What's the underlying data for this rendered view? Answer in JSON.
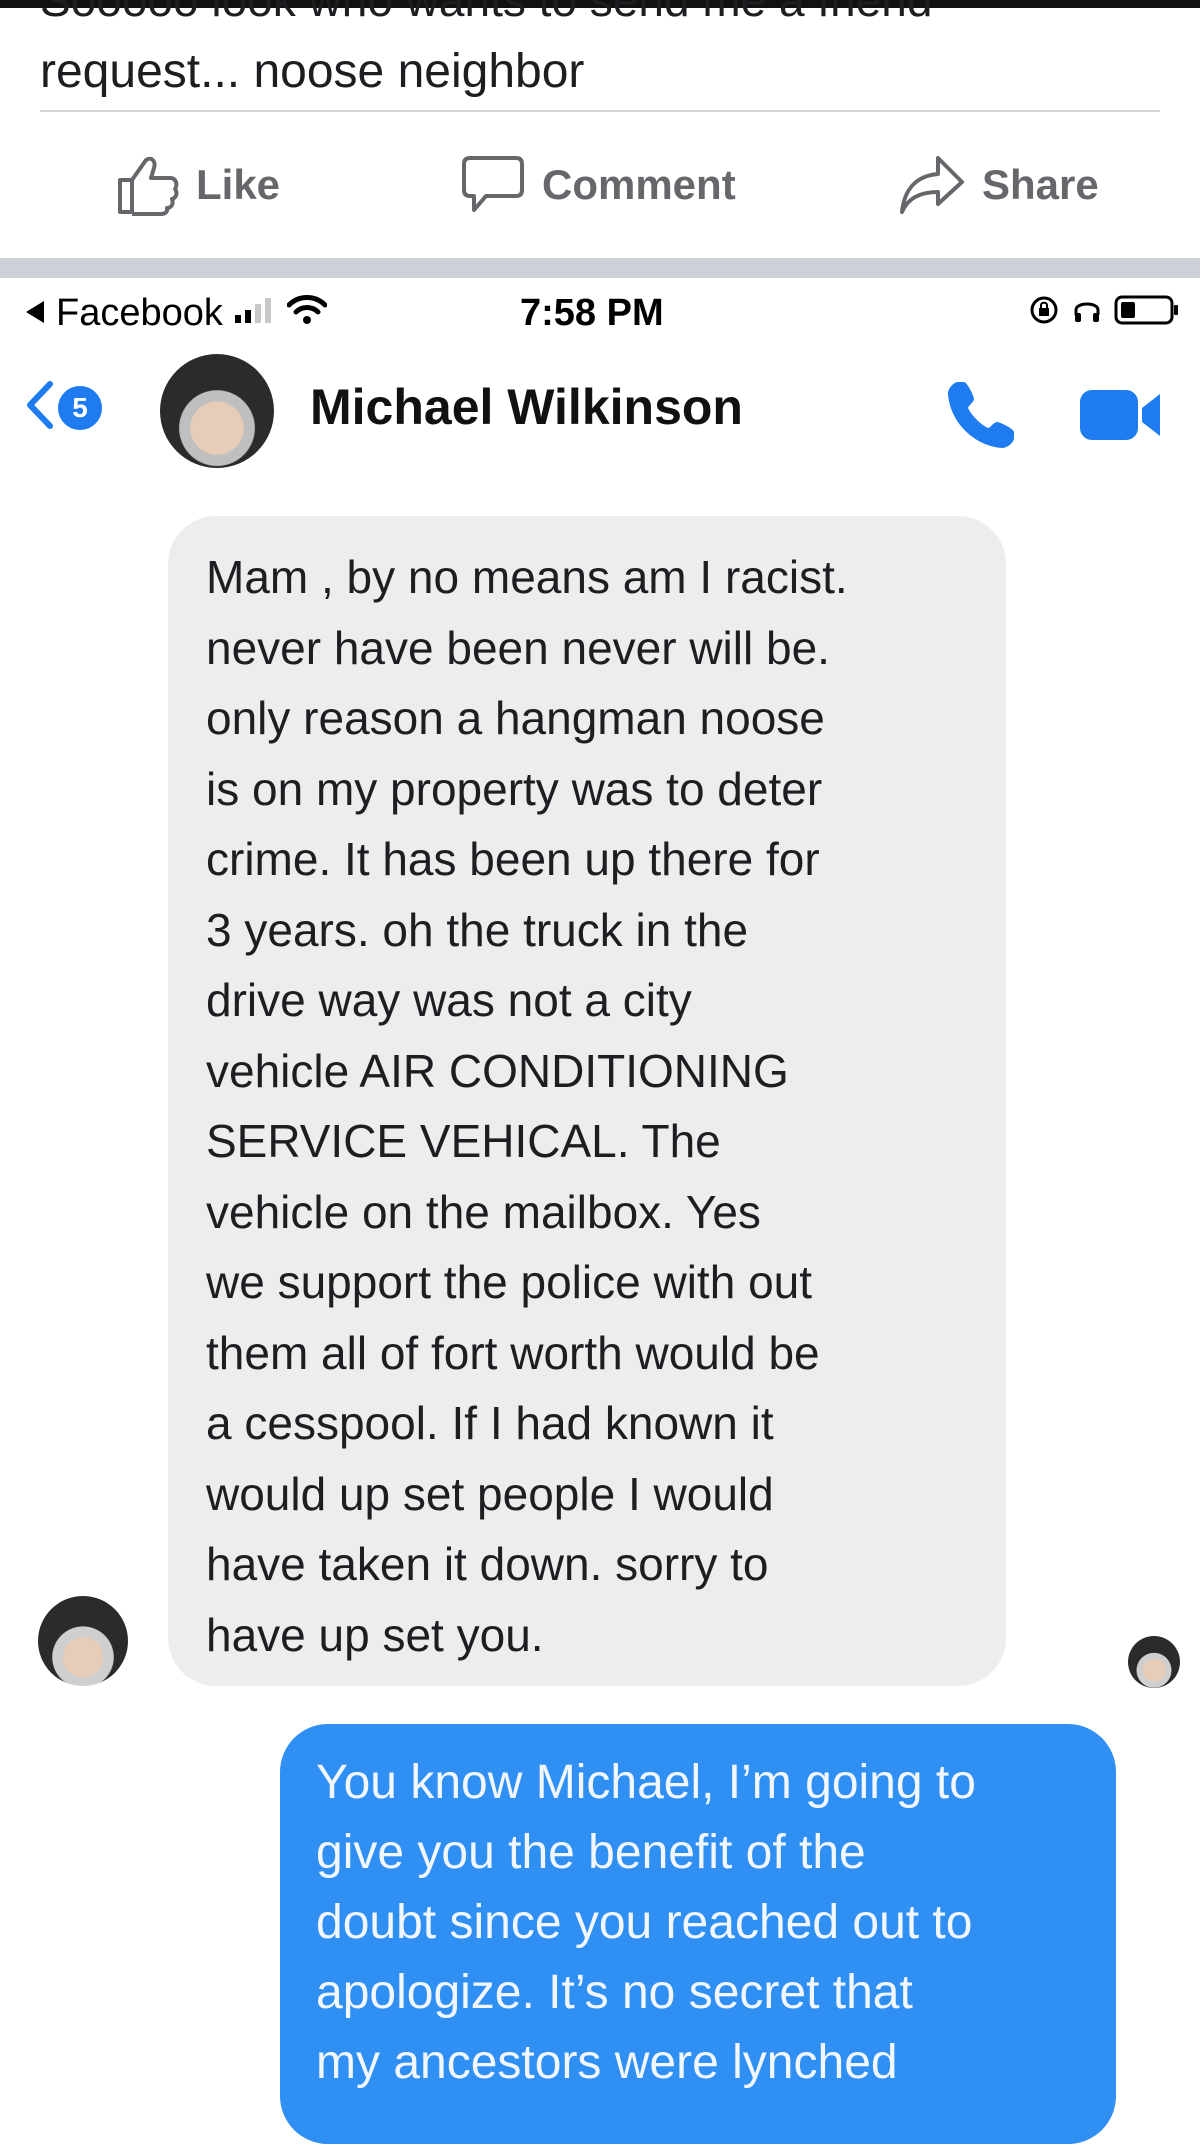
{
  "post": {
    "cut_line": "Sooooo look who wants to send me a friend",
    "text": "request... noose neighbor",
    "actions": [
      {
        "label": "Like",
        "icon": "thumbs-up-icon"
      },
      {
        "label": "Comment",
        "icon": "speech-bubble-icon"
      },
      {
        "label": "Share",
        "icon": "share-arrow-icon"
      }
    ]
  },
  "status_bar": {
    "back_app": "Facebook",
    "time": "7:58 PM",
    "icons": [
      "back-triangle-icon",
      "signal-bars-icon",
      "wifi-icon",
      "lock-rotation-icon",
      "headphones-icon",
      "battery-icon"
    ]
  },
  "chat": {
    "unread_count": "5",
    "contact_name": "Michael Wilkinson",
    "header_icons": [
      "back-chevron-icon",
      "phone-icon",
      "video-camera-icon"
    ],
    "accent_color": "#1e7cf0",
    "incoming_message": "Mam , by no means am I racist.\nnever have been never will be.\nonly reason a hangman noose\nis on my property was to deter\ncrime. It has been up there for\n3 years. oh the truck in the\ndrive way was not a city\nvehicle AIR CONDITIONING\nSERVICE VEHICAL.    The\nvehicle on the mailbox.   Yes\nwe support the police with out\nthem all of fort worth would be\na cesspool.   If I had known it\nwould up set people I would\nhave taken it down.   sorry to\nhave up set you.",
    "outgoing_message": "You know Michael, I’m going to\ngive you the benefit of the\ndoubt since you reached out to\napologize. It’s no secret that\nmy ancestors were lynched",
    "outgoing_color": "#2f8ff3",
    "incoming_color": "#ededee"
  }
}
